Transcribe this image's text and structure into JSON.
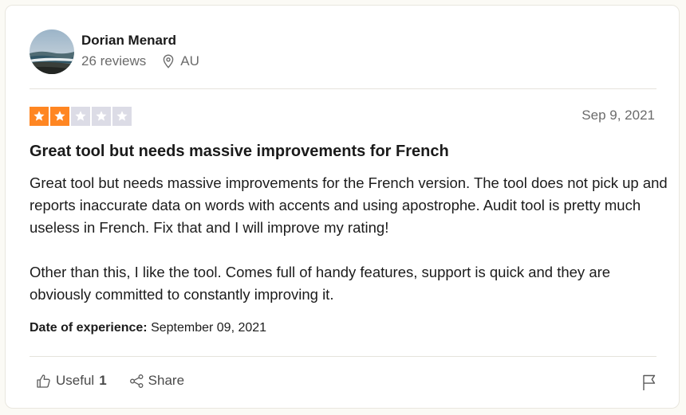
{
  "reviewer": {
    "name": "Dorian Menard",
    "reviews": "26 reviews",
    "country": "AU"
  },
  "review": {
    "rating": 2,
    "max_rating": 5,
    "date": "Sep 9, 2021",
    "title": "Great tool but needs massive improvements for French",
    "paragraph1": "Great tool but needs massive improvements for the French version. The tool does not pick up and reports inaccurate data on words with accents and using apostrophe. Audit tool is pretty much useless in French. Fix that and I will improve my rating!",
    "paragraph2": "Other than this, I like the tool. Comes full of handy features, support is quick and they are obviously committed to constantly improving it.",
    "experience_label": "Date of experience:",
    "experience_date": "September 09, 2021"
  },
  "actions": {
    "useful_label": "Useful",
    "useful_count": "1",
    "share_label": "Share"
  },
  "colors": {
    "star_on": "#ff8622",
    "star_off": "#dcdce6",
    "muted_text": "#6b6b6b"
  },
  "icons": {
    "location": "location-pin-icon",
    "useful": "thumbs-up-icon",
    "share": "share-icon",
    "report": "flag-icon"
  }
}
